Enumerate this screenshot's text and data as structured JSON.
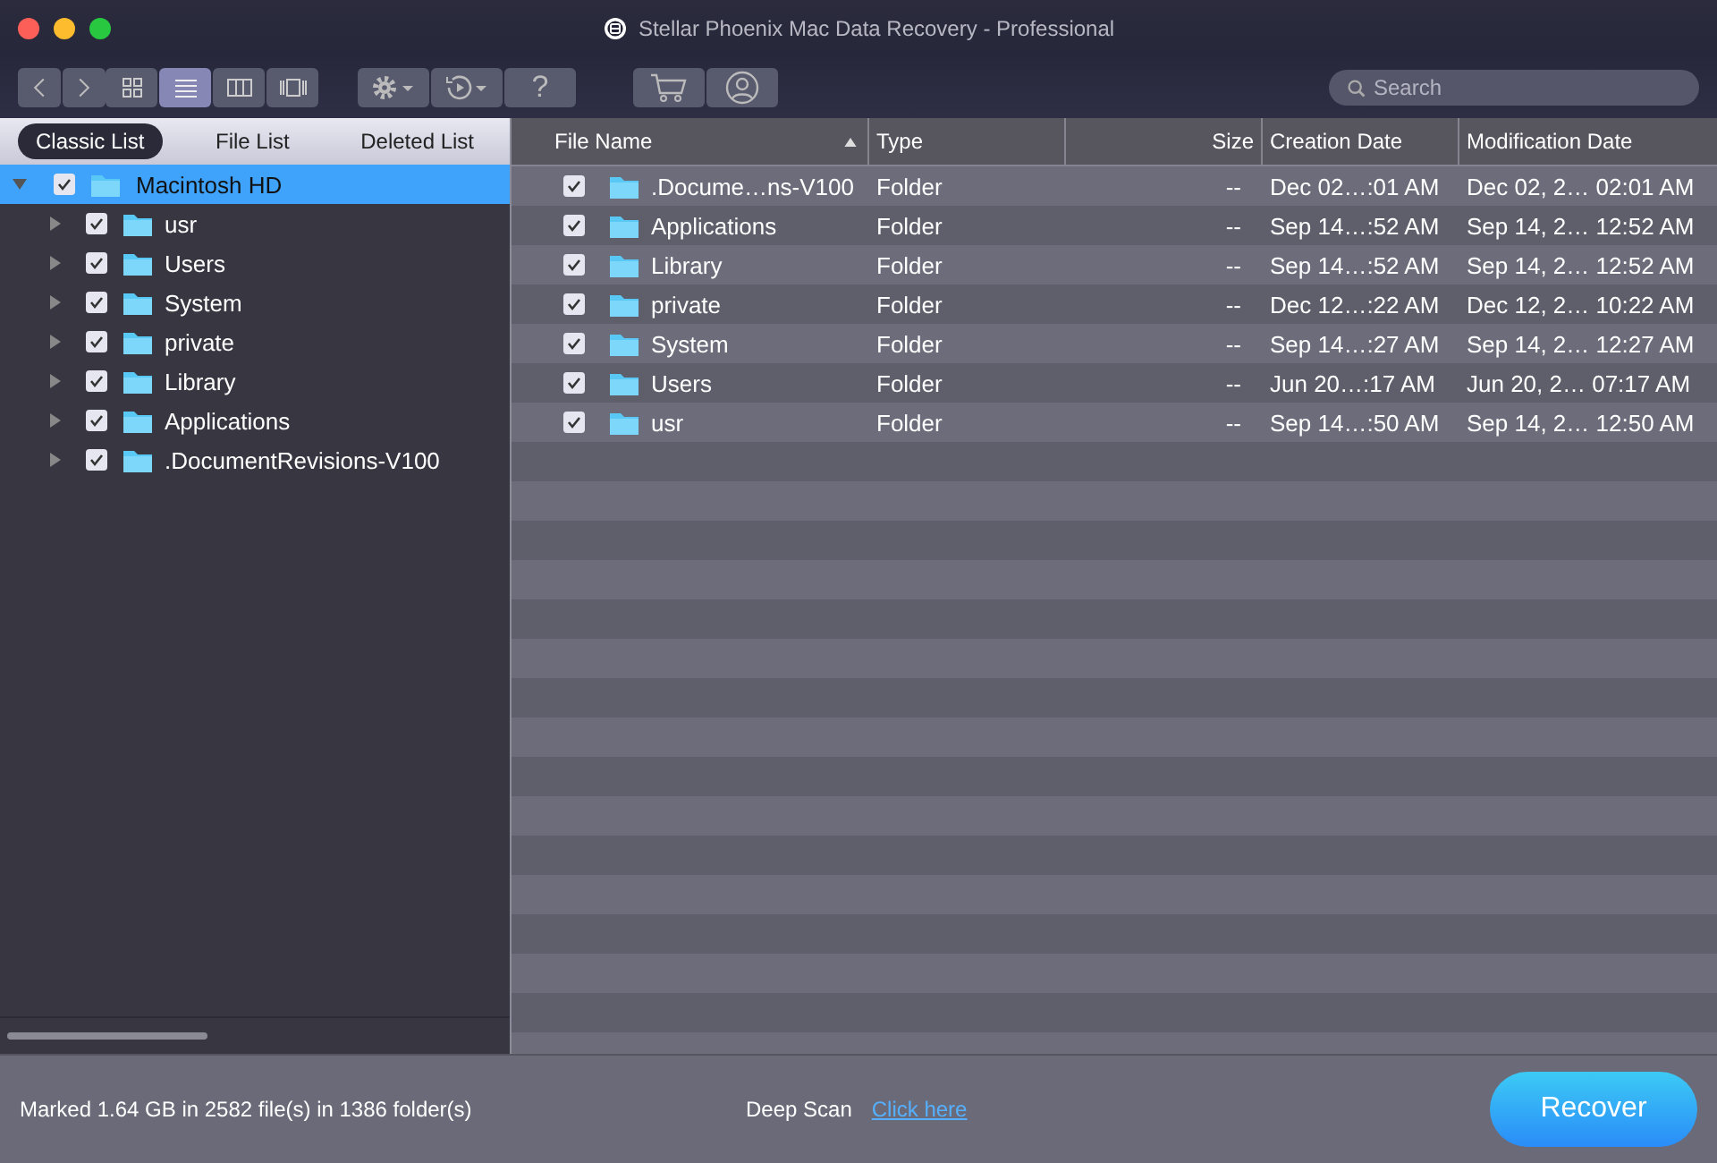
{
  "window": {
    "title": "Stellar Phoenix Mac Data Recovery - Professional"
  },
  "view_modes": [
    {
      "kind": "grid",
      "selected": false
    },
    {
      "kind": "list",
      "selected": true
    },
    {
      "kind": "columns",
      "selected": false
    },
    {
      "kind": "coverflow",
      "selected": false
    }
  ],
  "help_button": "?",
  "search": {
    "placeholder": "Search"
  },
  "tabs": [
    {
      "label": "Classic List",
      "selected": true
    },
    {
      "label": "File List",
      "selected": false
    },
    {
      "label": "Deleted List",
      "selected": false
    }
  ],
  "tree": {
    "label": "Macintosh HD",
    "checked": true,
    "expanded": true,
    "selected": true,
    "children": [
      {
        "label": "usr",
        "checked": true,
        "expanded": false,
        "selected": false
      },
      {
        "label": "Users",
        "checked": true,
        "expanded": false,
        "selected": false
      },
      {
        "label": "System",
        "checked": true,
        "expanded": false,
        "selected": false
      },
      {
        "label": "private",
        "checked": true,
        "expanded": false,
        "selected": false
      },
      {
        "label": "Library",
        "checked": true,
        "expanded": false,
        "selected": false
      },
      {
        "label": "Applications",
        "checked": true,
        "expanded": false,
        "selected": false
      },
      {
        "label": ".DocumentRevisions-V100",
        "checked": true,
        "expanded": false,
        "selected": false
      }
    ]
  },
  "table": {
    "columns": [
      {
        "label": "File Name",
        "sorted": true
      },
      {
        "label": "Type",
        "sorted": false
      },
      {
        "label": "Size",
        "sorted": false
      },
      {
        "label": "Creation Date",
        "sorted": false
      },
      {
        "label": "Modification Date",
        "sorted": false
      }
    ],
    "rows": [
      {
        "checked": true,
        "name": ".Docume…ns-V100",
        "type": "Folder",
        "size": "--",
        "created": "Dec 02…:01 AM",
        "modified": "Dec 02, 2… 02:01 AM"
      },
      {
        "checked": true,
        "name": "Applications",
        "type": "Folder",
        "size": "--",
        "created": "Sep 14…:52 AM",
        "modified": "Sep 14, 2… 12:52 AM"
      },
      {
        "checked": true,
        "name": "Library",
        "type": "Folder",
        "size": "--",
        "created": "Sep 14…:52 AM",
        "modified": "Sep 14, 2… 12:52 AM"
      },
      {
        "checked": true,
        "name": "private",
        "type": "Folder",
        "size": "--",
        "created": "Dec 12…:22 AM",
        "modified": "Dec 12, 2… 10:22 AM"
      },
      {
        "checked": true,
        "name": "System",
        "type": "Folder",
        "size": "--",
        "created": "Sep 14…:27 AM",
        "modified": "Sep 14, 2… 12:27 AM"
      },
      {
        "checked": true,
        "name": "Users",
        "type": "Folder",
        "size": "--",
        "created": "Jun 20…:17 AM",
        "modified": "Jun 20, 2… 07:17 AM"
      },
      {
        "checked": true,
        "name": "usr",
        "type": "Folder",
        "size": "--",
        "created": "Sep 14…:50 AM",
        "modified": "Sep 14, 2… 12:50 AM"
      }
    ]
  },
  "status_bar": {
    "summary": "Marked 1.64 GB in 2582 file(s) in 1386 folder(s)",
    "deep_scan_label": "Deep Scan",
    "deep_scan_link": "Click here",
    "recover_button": "Recover"
  }
}
